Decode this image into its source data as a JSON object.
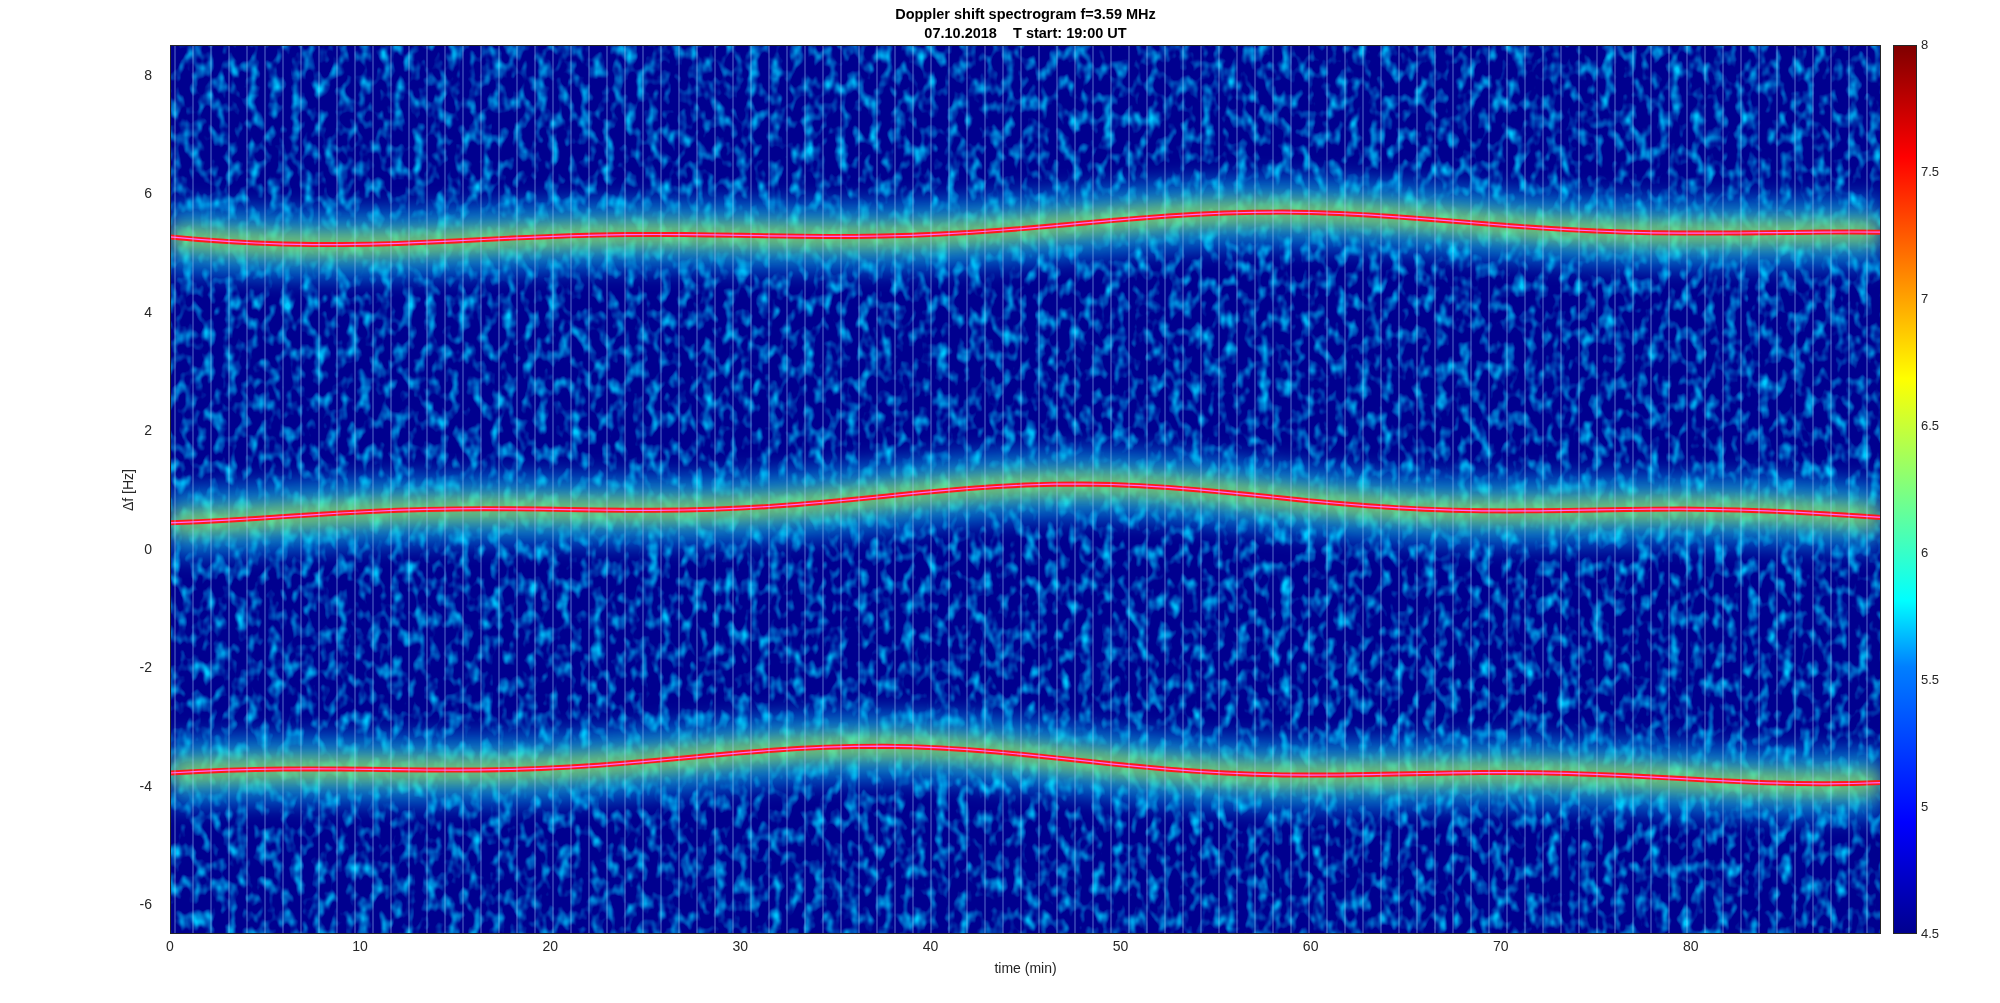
{
  "figure": {
    "title": [
      "Doppler shift spectrogram f=3.59 MHz",
      "07.10.2018    T start: 19:00 UT"
    ],
    "axes": {
      "xlabel": "time (min)",
      "ylabel": "Δf [Hz]",
      "xticks": [
        "0",
        "10",
        "20",
        "30",
        "40",
        "50",
        "60",
        "70",
        "80"
      ],
      "yticks": [
        "8",
        "6",
        "4",
        "2",
        "0",
        "-2",
        "-4",
        "-6"
      ]
    },
    "colorbar": {
      "ticks": [
        "8",
        "7.5",
        "7",
        "6.5",
        "6",
        "5.5",
        "5",
        "4.5"
      ]
    }
  }
}
